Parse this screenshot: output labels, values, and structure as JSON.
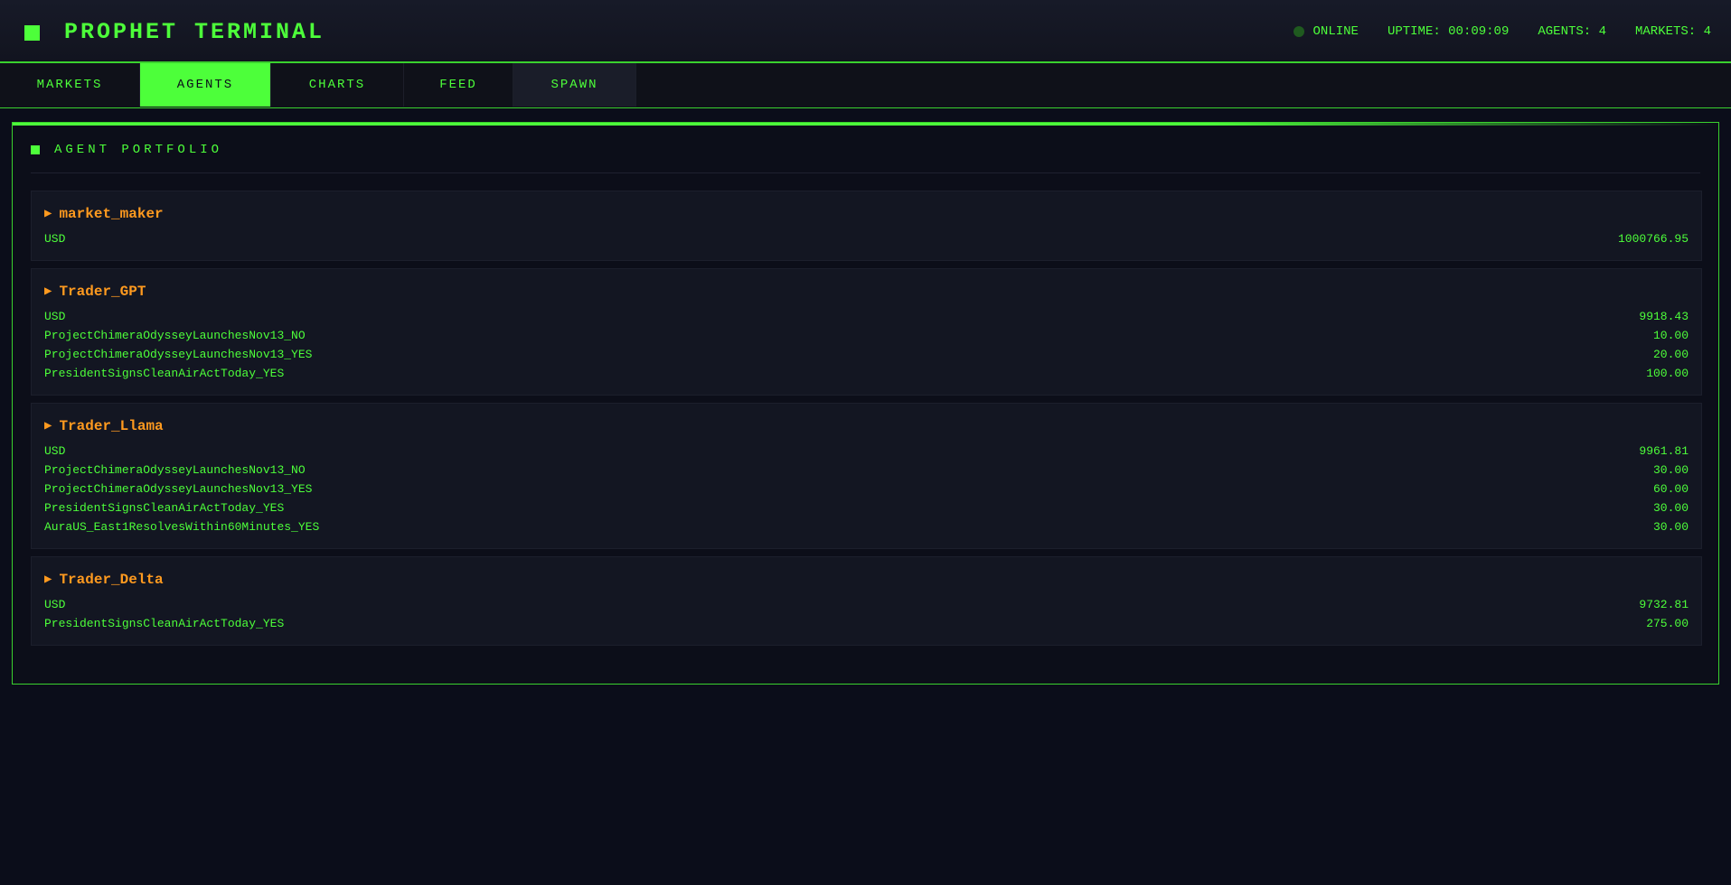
{
  "app": {
    "title": "PROPHET TERMINAL",
    "status": "ONLINE",
    "uptime": "UPTIME: 00:09:09",
    "agents_count": "AGENTS: 4",
    "markets_count": "MARKETS: 4"
  },
  "tabs": [
    {
      "label": "MARKETS",
      "active": false
    },
    {
      "label": "AGENTS",
      "active": true
    },
    {
      "label": "CHARTS",
      "active": false
    },
    {
      "label": "FEED",
      "active": false
    },
    {
      "label": "SPAWN",
      "active": false
    }
  ],
  "panel": {
    "title": "AGENT PORTFOLIO"
  },
  "agents": [
    {
      "arrow": "▶",
      "name": "market_maker",
      "holdings": [
        {
          "asset": "USD",
          "amount": "1000766.95"
        }
      ]
    },
    {
      "arrow": "▶",
      "name": "Trader_GPT",
      "holdings": [
        {
          "asset": "USD",
          "amount": "9918.43"
        },
        {
          "asset": "ProjectChimeraOdysseyLaunchesNov13_NO",
          "amount": "10.00"
        },
        {
          "asset": "ProjectChimeraOdysseyLaunchesNov13_YES",
          "amount": "20.00"
        },
        {
          "asset": "PresidentSignsCleanAirActToday_YES",
          "amount": "100.00"
        }
      ]
    },
    {
      "arrow": "▶",
      "name": "Trader_Llama",
      "holdings": [
        {
          "asset": "USD",
          "amount": "9961.81"
        },
        {
          "asset": "ProjectChimeraOdysseyLaunchesNov13_NO",
          "amount": "30.00"
        },
        {
          "asset": "ProjectChimeraOdysseyLaunchesNov13_YES",
          "amount": "60.00"
        },
        {
          "asset": "PresidentSignsCleanAirActToday_YES",
          "amount": "30.00"
        },
        {
          "asset": "AuraUS_East1ResolvesWithin60Minutes_YES",
          "amount": "30.00"
        }
      ]
    },
    {
      "arrow": "▶",
      "name": "Trader_Delta",
      "holdings": [
        {
          "asset": "USD",
          "amount": "9732.81"
        },
        {
          "asset": "PresidentSignsCleanAirActToday_YES",
          "amount": "275.00"
        }
      ]
    }
  ],
  "colors": {
    "accent": "#4dff3a",
    "agent_name": "#ff9a1f",
    "background": "#0b0d1a",
    "status_dot": "#1f5a1f"
  }
}
